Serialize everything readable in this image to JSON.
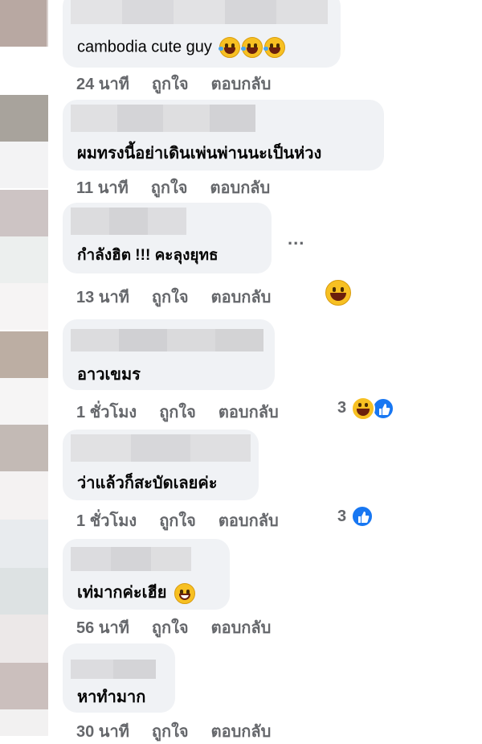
{
  "comments": [
    {
      "text": "cambodia cute guy",
      "time": "24 นาที",
      "like": "ถูกใจ",
      "reply": "ตอบกลับ"
    },
    {
      "text": "ผมทรงนี้อย่าเดินเพ่นพ่านนะเป็นห่วง",
      "time": "11 นาที",
      "like": "ถูกใจ",
      "reply": "ตอบกลับ"
    },
    {
      "text": "กำลังฮิต !!! คะลุงยุทธ",
      "time": "13 นาที",
      "like": "ถูกใจ",
      "reply": "ตอบกลับ"
    },
    {
      "text": "อาวเขมร",
      "time": "1 ชั่วโมง",
      "like": "ถูกใจ",
      "reply": "ตอบกลับ",
      "reactions": "3"
    },
    {
      "text": "ว่าแล้วก็สะบัดเลยค่ะ",
      "time": "1 ชั่วโมง",
      "like": "ถูกใจ",
      "reply": "ตอบกลับ",
      "reactions": "3"
    },
    {
      "text": "เท่มากค่ะเฮีย",
      "time": "56 นาที",
      "like": "ถูกใจ",
      "reply": "ตอบกลับ"
    },
    {
      "text": "หาทำมาก",
      "time": "30 นาที",
      "like": "ถูกใจ",
      "reply": "ตอบกลับ"
    }
  ],
  "more_options": "...",
  "icons": {
    "laugh": "rofl-emoji-icon",
    "grin": "grinning-emoji-icon",
    "like": "like-reaction-icon"
  },
  "colors": {
    "bubble": "#f0f2f5",
    "meta_text": "#65676b",
    "like_blue": "#1877f2"
  }
}
